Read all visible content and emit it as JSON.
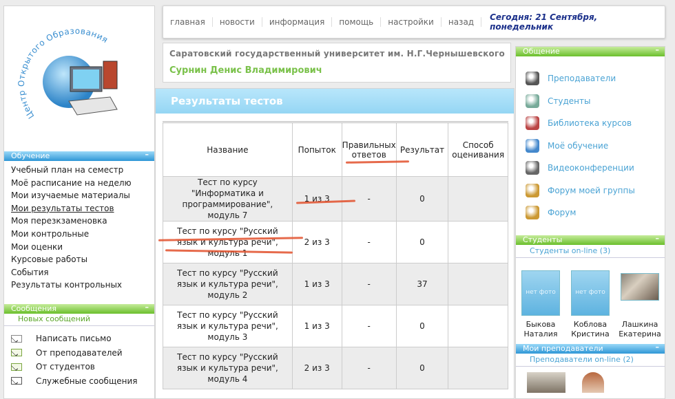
{
  "logo": {
    "arc_text": "Центр Открытого Образования"
  },
  "nav": {
    "items": [
      "главная",
      "новости",
      "информация",
      "помощь",
      "настройки",
      "назад"
    ],
    "date": "Сегодня: 21 Сентября, понедельник"
  },
  "header": {
    "university": "Саратовский государственный университет им. Н.Г.Чернышевского",
    "user": "Сурнин Денис Владимирович"
  },
  "left": {
    "study_title": "Обучение",
    "study_menu": [
      "Учебный план на семестр",
      "Моё расписание на неделю",
      "Мои изучаемые материалы",
      "Мои результаты тестов",
      "Моя перезкзаменовка",
      "Мои контрольные",
      "Мои оценки",
      "Курсовые работы",
      "События",
      "Результаты контрольных"
    ],
    "messages_title": "Сообщения",
    "new_messages": "Новых сообщений",
    "messages_menu": [
      {
        "label": "Написать письмо",
        "icon": "pencil-envelope-icon"
      },
      {
        "label": "От преподавателей",
        "icon": "envelope-icon"
      },
      {
        "label": "От студентов",
        "icon": "envelope-icon"
      },
      {
        "label": "Служебные сообщения",
        "icon": "envelope-icon"
      }
    ]
  },
  "main": {
    "title": "Результаты тестов",
    "columns": [
      "Название",
      "Попыток",
      "Правильных ответов",
      "Результат",
      "Способ оценивания"
    ],
    "rows": [
      {
        "name": "Тест по курсу \"Информатика и программирование\", модуль 7",
        "attempts": "1 из 3",
        "correct": "-",
        "result": "0",
        "method": ""
      },
      {
        "name": "Тест по курсу \"Русский язык и культура речи\", модуль 1",
        "attempts": "2 из 3",
        "correct": "-",
        "result": "0",
        "method": ""
      },
      {
        "name": "Тест по курсу \"Русский язык и культура речи\", модуль 2",
        "attempts": "1 из 3",
        "correct": "-",
        "result": "37",
        "method": ""
      },
      {
        "name": "Тест по курсу \"Русский язык и культура речи\", модуль 3",
        "attempts": "1 из 3",
        "correct": "-",
        "result": "0",
        "method": ""
      },
      {
        "name": "Тест по курсу \"Русский язык и культура речи\", модуль 4",
        "attempts": "2 из 3",
        "correct": "-",
        "result": "0",
        "method": ""
      }
    ]
  },
  "right": {
    "comm_title": "Общение",
    "comm_menu": [
      {
        "label": "Преподаватели",
        "icon": "teacher-icon"
      },
      {
        "label": "Студенты",
        "icon": "students-icon"
      },
      {
        "label": "Библиотека курсов",
        "icon": "books-icon"
      },
      {
        "label": "Моё обучение",
        "icon": "book-icon"
      },
      {
        "label": "Видеоконференции",
        "icon": "camera-icon"
      },
      {
        "label": "Форум моей группы",
        "icon": "group-forum-icon"
      },
      {
        "label": "Форум",
        "icon": "forum-icon"
      }
    ],
    "students_title": "Студенты",
    "students_online": "Студенты on-line (3)",
    "students": [
      {
        "first": "Быкова",
        "last": "Наталия",
        "photo": "нет фото"
      },
      {
        "first": "Коблова",
        "last": "Кристина",
        "photo": "нет фото"
      },
      {
        "first": "Лашкина",
        "last": "Екатерина",
        "photo": ""
      }
    ],
    "teachers_title": "Мои преподаватели",
    "teachers_online": "Преподаватели on-line (2)"
  },
  "colors": {
    "accent_blue": "#2f97d6",
    "accent_green": "#6bbf2c",
    "date_color": "#1a2f8a",
    "annotation_red": "#e2502b"
  }
}
